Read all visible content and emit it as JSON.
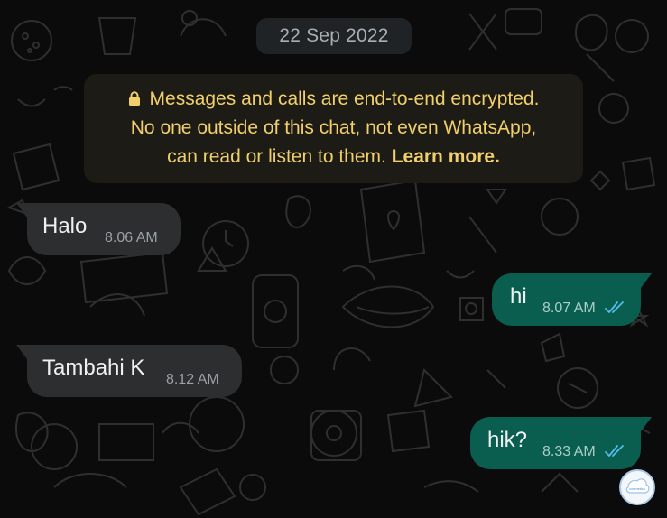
{
  "date_chip": "22 Sep 2022",
  "encryption_notice": {
    "icon": "lock-icon",
    "line1": "Messages and calls are end-to-end encrypted.",
    "line2": "No one outside of this chat, not even WhatsApp,",
    "line3_prefix": "can read or listen to them. ",
    "learn_more": "Learn more."
  },
  "messages": [
    {
      "direction": "incoming",
      "text": "Halo",
      "time": "8.06 AM"
    },
    {
      "direction": "outgoing",
      "text": "hi",
      "time": "8.07 AM",
      "status": "read"
    },
    {
      "direction": "incoming",
      "text": "Tambahi K",
      "time": "8.12 AM"
    },
    {
      "direction": "outgoing",
      "text": "hik?",
      "time": "8.33 AM",
      "status": "read"
    }
  ],
  "stamp_text": "cosmetics",
  "colors": {
    "background": "#0b0b0b",
    "incoming_bubble": "#2c2e30",
    "outgoing_bubble": "#0a5e4f",
    "notice_text": "#f1cf6a",
    "read_tick": "#53bdeb"
  }
}
